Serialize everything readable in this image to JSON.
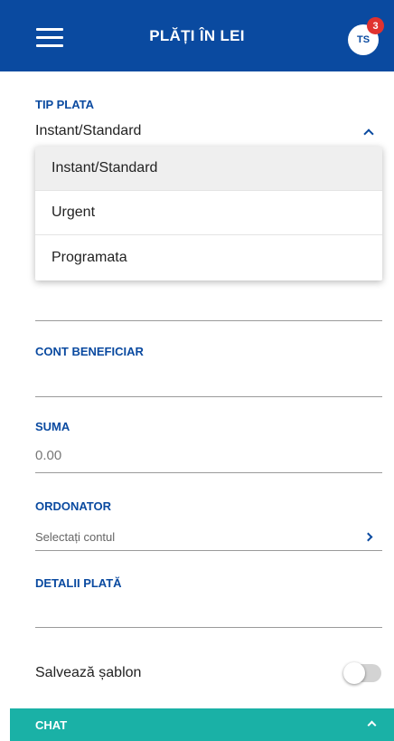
{
  "header": {
    "title": "PLĂȚI ÎN LEI",
    "avatar_initials": "TS",
    "notification_count": "3",
    "brand_color": "#0a4aa0"
  },
  "tip_plata": {
    "label": "TIP PLATA",
    "value": "Instant/Standard",
    "options": [
      "Instant/Standard",
      "Urgent",
      "Programata"
    ],
    "selected_index": 0
  },
  "cont_beneficiar": {
    "label": "CONT BENEFICIAR"
  },
  "suma": {
    "label": "SUMA",
    "value": "0.00"
  },
  "ordonator": {
    "label": "ORDONATOR",
    "placeholder": "Selectați contul"
  },
  "detalii": {
    "label": "DETALII PLATĂ"
  },
  "sablon": {
    "label": "Salvează șablon",
    "enabled": false
  },
  "chat": {
    "label": "CHAT",
    "color": "#1ab1a6"
  },
  "icons": {
    "menu": "hamburger-menu-icon",
    "dropdown": "chevron-up-icon",
    "ordonator": "chevron-right-icon",
    "chat": "chevron-up-icon"
  }
}
